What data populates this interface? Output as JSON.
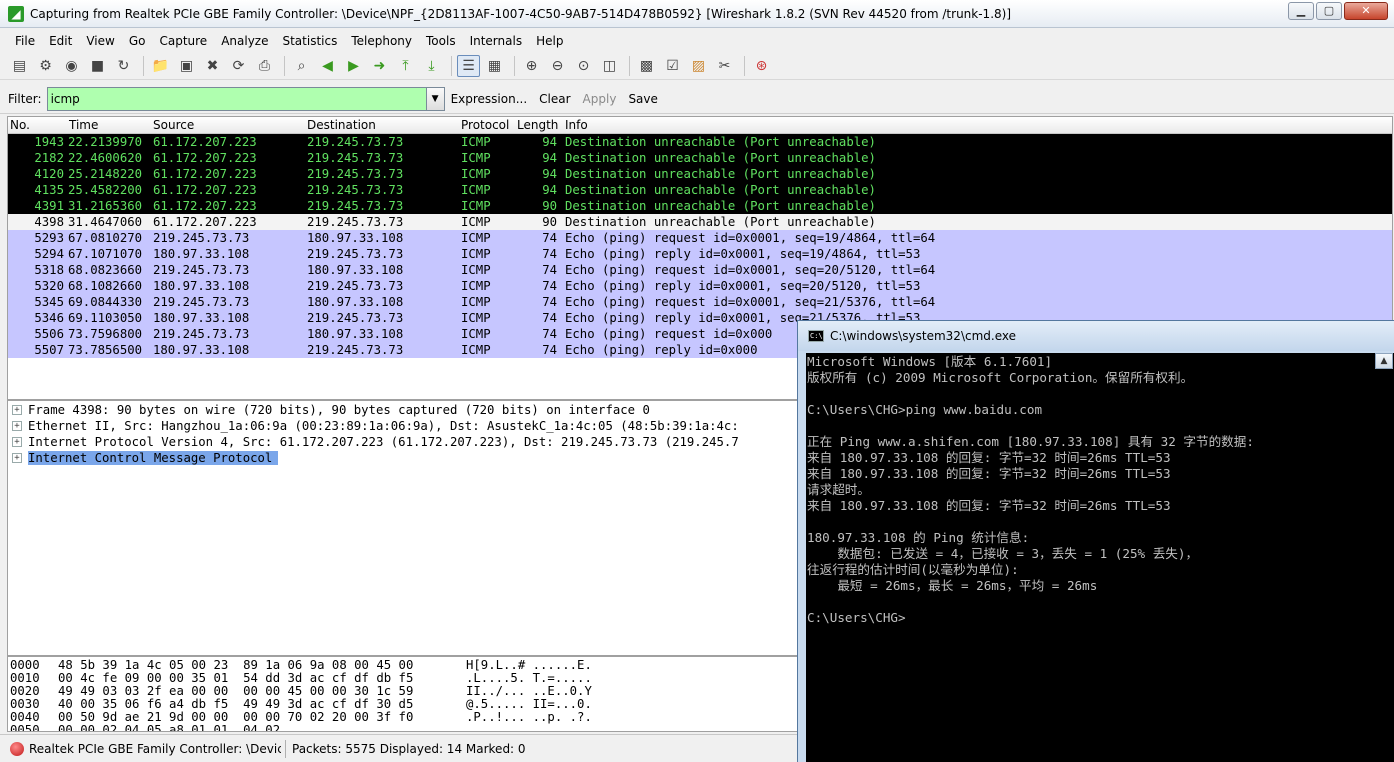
{
  "window": {
    "title": "Capturing from Realtek PCIe GBE Family Controller: \\Device\\NPF_{2D8113AF-1007-4C50-9AB7-514D478B0592}   [Wireshark 1.8.2  (SVN Rev 44520 from /trunk-1.8)]"
  },
  "menu": [
    "File",
    "Edit",
    "View",
    "Go",
    "Capture",
    "Analyze",
    "Statistics",
    "Telephony",
    "Tools",
    "Internals",
    "Help"
  ],
  "toolbar_icons": [
    "interface-list-icon",
    "capture-options-icon",
    "start-capture-icon",
    "stop-capture-icon",
    "restart-capture-icon",
    "open-file-icon",
    "save-file-icon",
    "close-file-icon",
    "reload-file-icon",
    "print-icon",
    "find-packet-icon",
    "go-back-icon",
    "go-forward-icon",
    "go-to-packet-icon",
    "go-first-icon",
    "go-last-icon",
    "colorize-icon",
    "auto-scroll-icon",
    "zoom-in-icon",
    "zoom-out-icon",
    "zoom-normal-icon",
    "resize-columns-icon",
    "capture-filters-icon",
    "display-filters-icon",
    "coloring-rules-icon",
    "preferences-icon",
    "help-icon"
  ],
  "filter": {
    "label": "Filter:",
    "value": "icmp",
    "expression": "Expression...",
    "clear": "Clear",
    "apply": "Apply",
    "save": "Save"
  },
  "packet_list": {
    "columns": [
      "No.",
      "Time",
      "Source",
      "Destination",
      "Protocol",
      "Length",
      "Info"
    ],
    "rows": [
      {
        "no": "1943",
        "time": "22.2139970",
        "src": "61.172.207.223",
        "dst": "219.245.73.73",
        "proto": "ICMP",
        "len": "94",
        "info": "Destination unreachable (Port unreachable)",
        "style": "black"
      },
      {
        "no": "2182",
        "time": "22.4600620",
        "src": "61.172.207.223",
        "dst": "219.245.73.73",
        "proto": "ICMP",
        "len": "94",
        "info": "Destination unreachable (Port unreachable)",
        "style": "black"
      },
      {
        "no": "4120",
        "time": "25.2148220",
        "src": "61.172.207.223",
        "dst": "219.245.73.73",
        "proto": "ICMP",
        "len": "94",
        "info": "Destination unreachable (Port unreachable)",
        "style": "black"
      },
      {
        "no": "4135",
        "time": "25.4582200",
        "src": "61.172.207.223",
        "dst": "219.245.73.73",
        "proto": "ICMP",
        "len": "94",
        "info": "Destination unreachable (Port unreachable)",
        "style": "black"
      },
      {
        "no": "4391",
        "time": "31.2165360",
        "src": "61.172.207.223",
        "dst": "219.245.73.73",
        "proto": "ICMP",
        "len": "90",
        "info": "Destination unreachable (Port unreachable)",
        "style": "black"
      },
      {
        "no": "4398",
        "time": "31.4647060",
        "src": "61.172.207.223",
        "dst": "219.245.73.73",
        "proto": "ICMP",
        "len": "90",
        "info": "Destination unreachable (Port unreachable)",
        "style": "sel"
      },
      {
        "no": "5293",
        "time": "67.0810270",
        "src": "219.245.73.73",
        "dst": "180.97.33.108",
        "proto": "ICMP",
        "len": "74",
        "info": "Echo (ping) request  id=0x0001, seq=19/4864, ttl=64",
        "style": "blue"
      },
      {
        "no": "5294",
        "time": "67.1071070",
        "src": "180.97.33.108",
        "dst": "219.245.73.73",
        "proto": "ICMP",
        "len": "74",
        "info": "Echo (ping) reply    id=0x0001, seq=19/4864, ttl=53",
        "style": "blue"
      },
      {
        "no": "5318",
        "time": "68.0823660",
        "src": "219.245.73.73",
        "dst": "180.97.33.108",
        "proto": "ICMP",
        "len": "74",
        "info": "Echo (ping) request  id=0x0001, seq=20/5120, ttl=64",
        "style": "blue"
      },
      {
        "no": "5320",
        "time": "68.1082660",
        "src": "180.97.33.108",
        "dst": "219.245.73.73",
        "proto": "ICMP",
        "len": "74",
        "info": "Echo (ping) reply    id=0x0001, seq=20/5120, ttl=53",
        "style": "blue"
      },
      {
        "no": "5345",
        "time": "69.0844330",
        "src": "219.245.73.73",
        "dst": "180.97.33.108",
        "proto": "ICMP",
        "len": "74",
        "info": "Echo (ping) request  id=0x0001, seq=21/5376, ttl=64",
        "style": "blue"
      },
      {
        "no": "5346",
        "time": "69.1103050",
        "src": "180.97.33.108",
        "dst": "219.245.73.73",
        "proto": "ICMP",
        "len": "74",
        "info": "Echo (ping) reply    id=0x0001, seq=21/5376, ttl=53",
        "style": "blue"
      },
      {
        "no": "5506",
        "time": "73.7596800",
        "src": "219.245.73.73",
        "dst": "180.97.33.108",
        "proto": "ICMP",
        "len": "74",
        "info": "Echo (ping) request  id=0x000",
        "style": "blue"
      },
      {
        "no": "5507",
        "time": "73.7856500",
        "src": "180.97.33.108",
        "dst": "219.245.73.73",
        "proto": "ICMP",
        "len": "74",
        "info": "Echo (ping) reply    id=0x000",
        "style": "blue"
      }
    ]
  },
  "detail": [
    {
      "text": "Frame 4398: 90 bytes on wire (720 bits), 90 bytes captured (720 bits) on interface 0",
      "highlighted": false
    },
    {
      "text": "Ethernet II, Src: Hangzhou_1a:06:9a (00:23:89:1a:06:9a), Dst: AsustekC_1a:4c:05 (48:5b:39:1a:4c:",
      "highlighted": false
    },
    {
      "text": "Internet Protocol Version 4, Src: 61.172.207.223 (61.172.207.223), Dst: 219.245.73.73 (219.245.7",
      "highlighted": false
    },
    {
      "text": "Internet Control Message Protocol",
      "highlighted": true
    }
  ],
  "hex": [
    {
      "off": "0000",
      "bytes": "48 5b 39 1a 4c 05 00 23  89 1a 06 9a 08 00 45 00",
      "ascii": "H[9.L..# ......E."
    },
    {
      "off": "0010",
      "bytes": "00 4c fe 09 00 00 35 01  54 dd 3d ac cf df db f5",
      "ascii": ".L....5. T.=....."
    },
    {
      "off": "0020",
      "bytes": "49 49 03 03 2f ea 00 00  00 00 45 00 00 30 1c 59",
      "ascii": "II../... ..E..0.Y"
    },
    {
      "off": "0030",
      "bytes": "40 00 35 06 f6 a4 db f5  49 49 3d ac cf df 30 d5",
      "ascii": "@.5..... II=...0."
    },
    {
      "off": "0040",
      "bytes": "00 50 9d ae 21 9d 00 00  00 00 70 02 20 00 3f f0",
      "ascii": ".P..!... ..p. .?."
    },
    {
      "off": "0050",
      "bytes": "00 00 02 04 05 a8 01 01  04 02",
      "ascii": ""
    }
  ],
  "status": {
    "interface": "Realtek PCIe GBE Family Controller: \\Devic...",
    "packets": "Packets: 5575 Displayed: 14 Marked: 0"
  },
  "cmd": {
    "title": "C:\\windows\\system32\\cmd.exe",
    "lines": [
      "Microsoft Windows [版本 6.1.7601]",
      "版权所有 (c) 2009 Microsoft Corporation。保留所有权利。",
      "",
      "C:\\Users\\CHG>ping www.baidu.com",
      "",
      "正在 Ping www.a.shifen.com [180.97.33.108] 具有 32 字节的数据:",
      "来自 180.97.33.108 的回复: 字节=32 时间=26ms TTL=53",
      "来自 180.97.33.108 的回复: 字节=32 时间=26ms TTL=53",
      "请求超时。",
      "来自 180.97.33.108 的回复: 字节=32 时间=26ms TTL=53",
      "",
      "180.97.33.108 的 Ping 统计信息:",
      "    数据包: 已发送 = 4，已接收 = 3，丢失 = 1 (25% 丢失)，",
      "往返行程的估计时间(以毫秒为单位):",
      "    最短 = 26ms，最长 = 26ms，平均 = 26ms",
      "",
      "C:\\Users\\CHG>"
    ]
  }
}
